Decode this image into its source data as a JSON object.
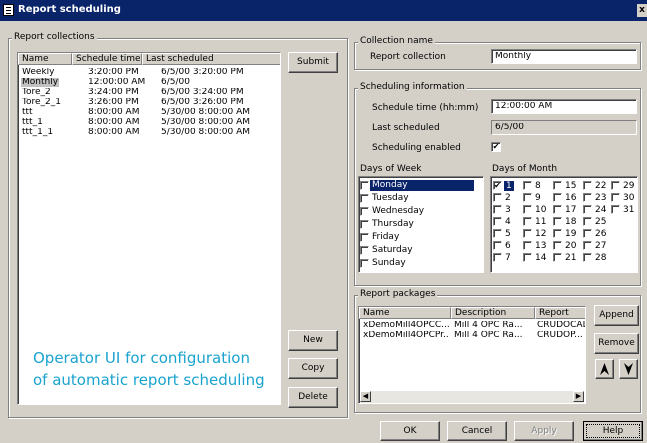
{
  "window": {
    "title": "Report scheduling",
    "close_label": "x"
  },
  "collections": {
    "legend": "Report collections",
    "headers": [
      "Name",
      "Schedule time",
      "Last scheduled"
    ],
    "rows": [
      {
        "name": "Weekly",
        "time": "3:20:00 PM",
        "last": "6/5/00 3:20:00 PM"
      },
      {
        "name": "Monthly",
        "time": "12:00:00 AM",
        "last": "6/5/00"
      },
      {
        "name": "Tore_2",
        "time": "3:24:00 PM",
        "last": "6/5/00 3:24:00 PM"
      },
      {
        "name": "Tore_2_1",
        "time": "3:26:00 PM",
        "last": "6/5/00 3:26:00 PM"
      },
      {
        "name": "ttt",
        "time": "8:00:00 AM",
        "last": "5/30/00 8:00:00 AM"
      },
      {
        "name": "ttt_1",
        "time": "8:00:00 AM",
        "last": "5/30/00 8:00:00 AM"
      },
      {
        "name": "ttt_1_1",
        "time": "8:00:00 AM",
        "last": "5/30/00 8:00:00 AM"
      }
    ],
    "buttons": {
      "submit": "Submit",
      "new": "New",
      "copy": "Copy",
      "delete": "Delete"
    }
  },
  "caption": {
    "line1": "Operator UI for configuration",
    "line2": "of automatic report scheduling"
  },
  "collection_name": {
    "legend": "Collection name",
    "label": "Report collection",
    "value": "Monthly"
  },
  "scheduling": {
    "legend": "Scheduling information",
    "time_label": "Schedule time (hh:mm)",
    "time_value": "12:00:00 AM",
    "last_label": "Last scheduled",
    "last_value": "6/5/00",
    "enabled_label": "Scheduling enabled",
    "enabled_mark": "✔"
  },
  "days_of_week": {
    "label": "Days of Week",
    "items": [
      "Monday",
      "Tuesday",
      "Wednesday",
      "Thursday",
      "Friday",
      "Saturday",
      "Sunday"
    ]
  },
  "days_of_month": {
    "label": "Days of Month",
    "columns": [
      [
        "1",
        "2",
        "3",
        "4",
        "5",
        "6",
        "7"
      ],
      [
        "8",
        "9",
        "10",
        "11",
        "12",
        "13",
        "14"
      ],
      [
        "15",
        "16",
        "17",
        "18",
        "19",
        "20",
        "21"
      ],
      [
        "22",
        "23",
        "24",
        "25",
        "26",
        "27",
        "28"
      ],
      [
        "29",
        "30",
        "31"
      ]
    ],
    "checked_mark": "✔"
  },
  "packages": {
    "legend": "Report packages",
    "headers": [
      "Name",
      "Description",
      "Report"
    ],
    "rows": [
      {
        "name": "xDemoMill4OPCC...",
        "desc": "Mill 4 OPC Ra...",
        "report": "CRUDOCAL"
      },
      {
        "name": "xDemoMill4OPCPr...",
        "desc": "Mill 4 OPC Ra...",
        "report": "CRUDOP..."
      }
    ],
    "buttons": {
      "append": "Append",
      "remove": "Remove"
    },
    "scroll_left": "◀",
    "scroll_right": "▶"
  },
  "footer": {
    "ok": "OK",
    "cancel": "Cancel",
    "apply": "Apply",
    "help": "Help"
  },
  "colors": {
    "selection": "#0a246a",
    "caption": "#1aa3cf",
    "face": "#d4d0c8"
  }
}
